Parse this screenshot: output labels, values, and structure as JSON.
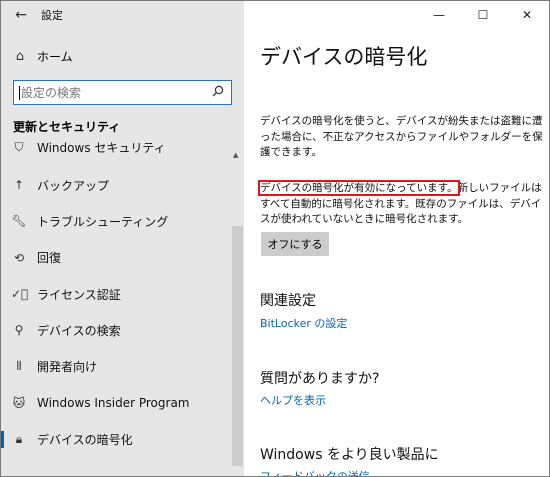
{
  "window": {
    "title": "設定"
  },
  "left": {
    "back_icon": "back-arrow-icon",
    "home_label": "ホーム",
    "search": {
      "placeholder": "設定の検索"
    },
    "section_title": "更新とセキュリティ",
    "items": [
      {
        "label": "Windows セキュリティ",
        "icon": "shield-icon"
      },
      {
        "label": "バックアップ",
        "icon": "backup-arrow-icon"
      },
      {
        "label": "トラブルシューティング",
        "icon": "wrench-icon"
      },
      {
        "label": "回復",
        "icon": "recovery-icon"
      },
      {
        "label": "ライセンス認証",
        "icon": "check-circle-icon"
      },
      {
        "label": "デバイスの検索",
        "icon": "person-location-icon"
      },
      {
        "label": "開発者向け",
        "icon": "developer-tools-icon"
      },
      {
        "label": "Windows Insider Program",
        "icon": "cat-icon"
      },
      {
        "label": "デバイスの暗号化",
        "icon": "lock-icon",
        "active": true
      }
    ]
  },
  "right": {
    "page_title": "デバイスの暗号化",
    "description": "デバイスの暗号化を使うと、デバイスが紛失または盗難に遭った場合に、不正なアクセスからファイルやフォルダーを保護できます。",
    "status_highlight": "デバイスの暗号化が有効になっています。",
    "status_rest": "新しいファイルはすべて自動的に暗号化されます。既存のファイルは、デバイスが使われていないときに暗号化されます。",
    "off_button": "オフにする",
    "related_title": "関連設定",
    "bitlocker_link": "BitLocker の設定",
    "question_title": "質問がありますか?",
    "help_link": "ヘルプを表示",
    "better_title": "Windows をより良い製品に",
    "feedback_link": "フィードバックの送信"
  },
  "colors": {
    "accent": "#0063b1",
    "link": "#0067b8",
    "highlight": "#e0151a",
    "left_bg": "#e6e6e6"
  }
}
